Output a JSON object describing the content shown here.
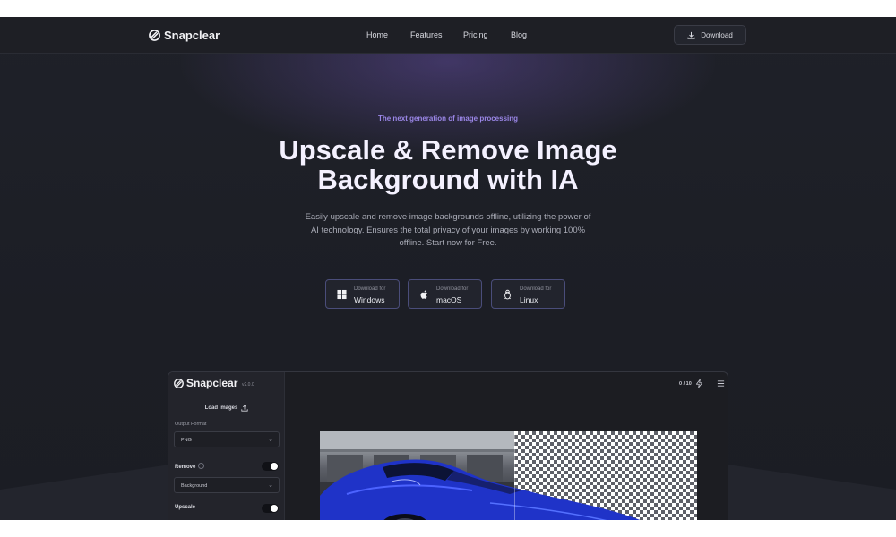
{
  "brand": {
    "name": "Snapclear"
  },
  "nav": {
    "links": [
      "Home",
      "Features",
      "Pricing",
      "Blog"
    ],
    "download_label": "Download"
  },
  "hero": {
    "eyebrow": "The next generation of image processing",
    "title_line1": "Upscale & Remove Image",
    "title_line2": "Background with IA",
    "subtitle": "Easily upscale and remove image backgrounds offline, utilizing the power of AI technology. Ensures the total privacy of your images by working 100% offline. Start now for Free.",
    "downloads": [
      {
        "small": "Download for",
        "os": "Windows",
        "icon": "windows-icon"
      },
      {
        "small": "Download for",
        "os": "macOS",
        "icon": "apple-icon"
      },
      {
        "small": "Download for",
        "os": "Linux",
        "icon": "linux-icon"
      }
    ]
  },
  "app": {
    "brand": "Snapclear",
    "version": "v2.0.0",
    "load_images_label": "Load images",
    "output_format_label": "Output Format",
    "output_format_value": "PNG",
    "remove_label": "Remove",
    "remove_enabled": true,
    "remove_option": "Background",
    "upscale_label": "Upscale",
    "upscale_enabled": true,
    "counter": "0 / 10"
  },
  "colors": {
    "accent": "#9b87e8",
    "background": "#1c1e25",
    "button_border": "#4a4d7a",
    "car_blue": "#1f33c8"
  }
}
